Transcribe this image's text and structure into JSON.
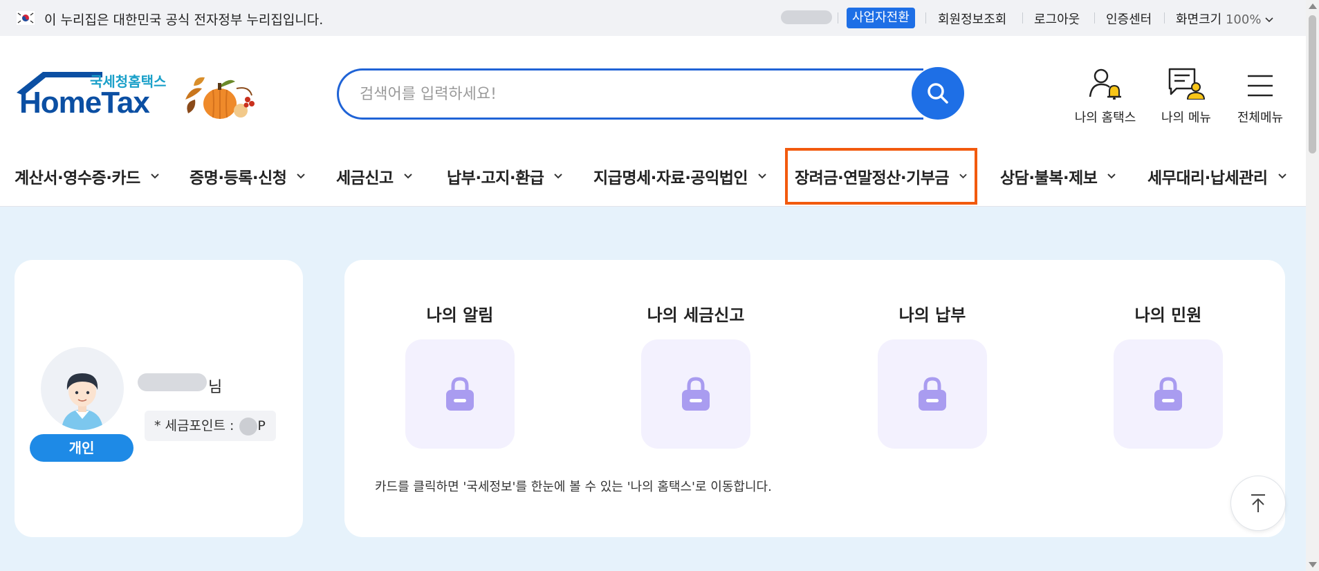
{
  "govbar": {
    "notice": "이 누리집은 대한민국 공식 전자정부 누리집입니다.",
    "switch_button": "사업자전환",
    "member_info": "회원정보조회",
    "logout": "로그아웃",
    "cert_center": "인증센터",
    "zoom_label": "화면크기",
    "zoom_value": "100%"
  },
  "header": {
    "logo_ko": "국세청홈택스",
    "logo_en": "HomeTax",
    "search_placeholder": "검색어를 입력하세요!",
    "utils": [
      "나의 홈택스",
      "나의 메뉴",
      "전체메뉴"
    ]
  },
  "nav": {
    "items": [
      "계산서·영수증·카드",
      "증명·등록·신청",
      "세금신고",
      "납부·고지·환급",
      "지급명세·자료·공익법인",
      "장려금·연말정산·기부금",
      "상담·불복·제보",
      "세무대리·납세관리"
    ],
    "active_index": 5
  },
  "profile": {
    "name_suffix": "님",
    "points_label": "* 세금포인트 : ",
    "points_unit": "P",
    "badge": "개인"
  },
  "dashboard": {
    "cards": [
      "나의 알림",
      "나의 세금신고",
      "나의 납부",
      "나의 민원"
    ],
    "note": "카드를 클릭하면 '국세정보'를 한눈에 볼 수 있는 '나의 홈택스'로 이동합니다."
  },
  "colors": {
    "brand_blue": "#1e6fe6",
    "highlight_orange": "#f25a0e",
    "logo_navy": "#0b4fa3",
    "lock_purple": "#a99cf0"
  }
}
